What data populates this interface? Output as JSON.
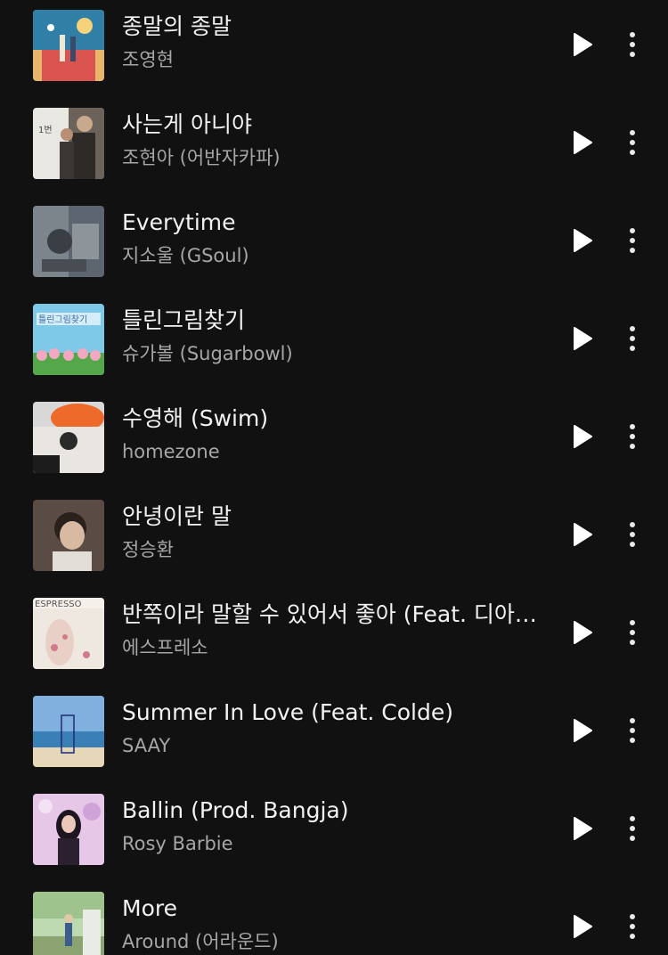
{
  "tracks": [
    {
      "title": "종말의 종말",
      "artist": "조영현",
      "art": "cover-art"
    },
    {
      "title": "사는게 아니야",
      "artist": "조현아 (어반자카파)",
      "art": "cover-art"
    },
    {
      "title": "Everytime",
      "artist": "지소울 (GSoul)",
      "art": "cover-art"
    },
    {
      "title": "틀린그림찾기",
      "artist": "슈가볼 (Sugarbowl)",
      "art": "cover-art"
    },
    {
      "title": "수영해 (Swim)",
      "artist": "homezone",
      "art": "cover-art"
    },
    {
      "title": "안녕이란 말",
      "artist": "정승환",
      "art": "cover-art"
    },
    {
      "title": "반쪽이라 말할 수 있어서 좋아 (Feat. 디아…",
      "artist": "에스프레소",
      "art": "cover-art"
    },
    {
      "title": "Summer In Love (Feat. Colde)",
      "artist": "SAAY",
      "art": "cover-art"
    },
    {
      "title": "Ballin (Prod. Bangja)",
      "artist": "Rosy Barbie",
      "art": "cover-art"
    },
    {
      "title": "More",
      "artist": "Around (어라운드)",
      "art": "cover-art"
    }
  ],
  "icons": {
    "play": "play-icon",
    "more": "more-vertical-icon"
  },
  "colors": {
    "background": "#111111",
    "title": "#f2f2f2",
    "artist": "#a6a6a6",
    "icon": "#ffffff"
  }
}
